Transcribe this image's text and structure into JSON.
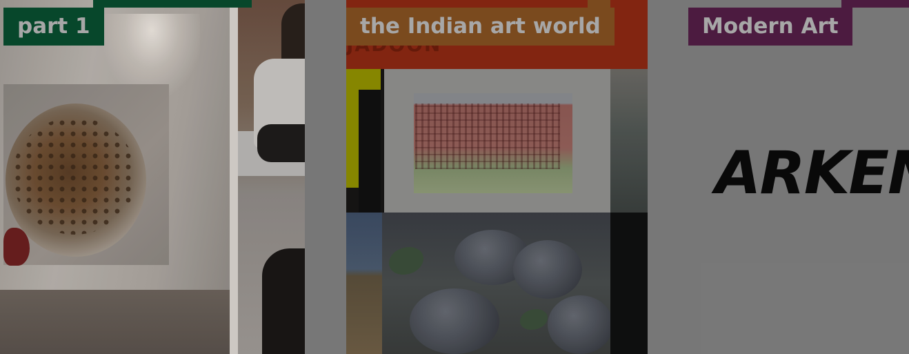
{
  "cards": [
    {
      "tag": "part 1",
      "tag_color": "#07472b"
    },
    {
      "tag": "the Indian art world",
      "tag_color": "#7a4a1e",
      "ghost_text": "JADOON"
    },
    {
      "tag": "Modern Art",
      "tag_color": "#4c1b40",
      "logo_text": "ARKEN"
    }
  ],
  "colors": {
    "tag_text": "#a7a7a7",
    "card_background": "#7e7e7e"
  }
}
